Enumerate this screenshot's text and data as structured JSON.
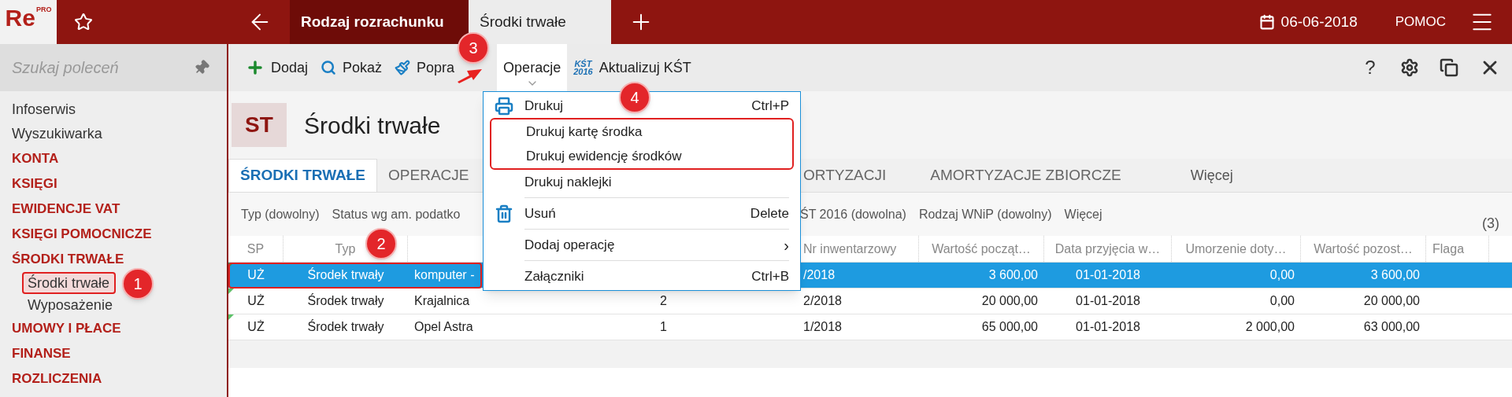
{
  "app": {
    "logo": "Re",
    "logo_badge": "PRO"
  },
  "top_tabs": [
    {
      "label": "Rodzaj rozrachunku",
      "selected": false
    },
    {
      "label": "Środki trwałe",
      "selected": true
    }
  ],
  "date": "06-06-2018",
  "help": "POMOC",
  "sidebar": {
    "search_placeholder": "Szukaj poleceń",
    "items": [
      {
        "label": "Infoserwis",
        "kind": "link"
      },
      {
        "label": "Wyszukiwarka",
        "kind": "link"
      },
      {
        "label": "KONTA",
        "kind": "section"
      },
      {
        "label": "KSIĘGI",
        "kind": "section"
      },
      {
        "label": "EWIDENCJE VAT",
        "kind": "section"
      },
      {
        "label": "KSIĘGI POMOCNICZE",
        "kind": "section"
      },
      {
        "label": "ŚRODKI TRWAŁE",
        "kind": "section",
        "children": [
          {
            "label": "Środki trwałe",
            "marked": true
          },
          {
            "label": "Wyposażenie",
            "marked": false
          }
        ]
      },
      {
        "label": "UMOWY I PŁACE",
        "kind": "section"
      },
      {
        "label": "FINANSE",
        "kind": "section"
      },
      {
        "label": "ROZLICZENIA",
        "kind": "section"
      }
    ]
  },
  "toolbar": [
    {
      "label": "Dodaj",
      "open": false
    },
    {
      "label": "Pokaż",
      "open": false
    },
    {
      "label": "Popra",
      "open": false
    },
    {
      "label": "Operacje",
      "open": true
    },
    {
      "label": "Aktualizuj KŚT",
      "icon_text": [
        "KŚT",
        "2016"
      ],
      "open": false
    }
  ],
  "help_glyph": "?",
  "page": {
    "badge": "ST",
    "title": "Środki trwałe"
  },
  "tabs": [
    {
      "label": "ŚRODKI TRWAŁE",
      "kind": "tab",
      "selected": true
    },
    {
      "label": "OPERACJE",
      "kind": "tab",
      "selected": false
    },
    {
      "label": "ORTYZACJI",
      "kind": "tab",
      "selected": false
    },
    {
      "label": "AMORTYZACJE ZBIORCZE",
      "kind": "tab",
      "selected": false
    },
    {
      "label": "Więcej",
      "kind": "more",
      "selected": false
    }
  ],
  "filters": [
    "Typ (dowolny)",
    "Status wg am. podatko",
    "ŚT 2016 (dowolna)",
    "Rodzaj WNiP (dowolny)",
    "Więcej"
  ],
  "count": "(3)",
  "table": {
    "columns": [
      {
        "label": "SP"
      },
      {
        "label": "Typ"
      },
      {},
      {},
      {
        "label": "Nr inwentarzowy"
      },
      {
        "label": "Wartość począt…"
      },
      {
        "label": "Data przyjęcia w…"
      },
      {
        "label": "Umorzenie doty…"
      },
      {
        "label": "Wartość pozost…"
      },
      {
        "label": "Flaga"
      }
    ],
    "rows": [
      {
        "selected": true,
        "marked": true,
        "cells": [
          "UŻ",
          "Środek trwały",
          "komputer -",
          null,
          "/2018",
          "3 600,00",
          "01-01-2018",
          "0,00",
          "3 600,00",
          null
        ]
      },
      {
        "selected": false,
        "marked": false,
        "cells": [
          "UŻ",
          "Środek trwały",
          "Krajalnica",
          "2",
          "2/2018",
          "20 000,00",
          "01-01-2018",
          "0,00",
          "20 000,00",
          null
        ]
      },
      {
        "selected": false,
        "marked": false,
        "cells": [
          "UŻ",
          "Środek trwały",
          "Opel Astra",
          "1",
          "1/2018",
          "65 000,00",
          "01-01-2018",
          "2 000,00",
          "63 000,00",
          null
        ]
      }
    ]
  },
  "menu": [
    {
      "kind": "item",
      "label": "Drukuj",
      "shortcut": "Ctrl+P",
      "marked": false
    },
    {
      "kind": "item",
      "label": "Drukuj kartę środka",
      "marked": true
    },
    {
      "kind": "item",
      "label": "Drukuj ewidencję środków",
      "marked": true
    },
    {
      "kind": "item",
      "label": "Drukuj naklejki",
      "marked": false
    },
    {
      "kind": "separator"
    },
    {
      "kind": "item",
      "label": "Usuń",
      "shortcut": "Delete",
      "marked": false
    },
    {
      "kind": "separator"
    },
    {
      "kind": "item",
      "label": "Dodaj operację",
      "submenu_glyph": "›",
      "marked": false
    },
    {
      "kind": "separator"
    },
    {
      "kind": "item",
      "label": "Załączniki",
      "shortcut": "Ctrl+B",
      "marked": false
    }
  ],
  "annotations": [
    {
      "label": "1"
    },
    {
      "label": "2"
    },
    {
      "label": "3"
    },
    {
      "label": "4"
    }
  ]
}
